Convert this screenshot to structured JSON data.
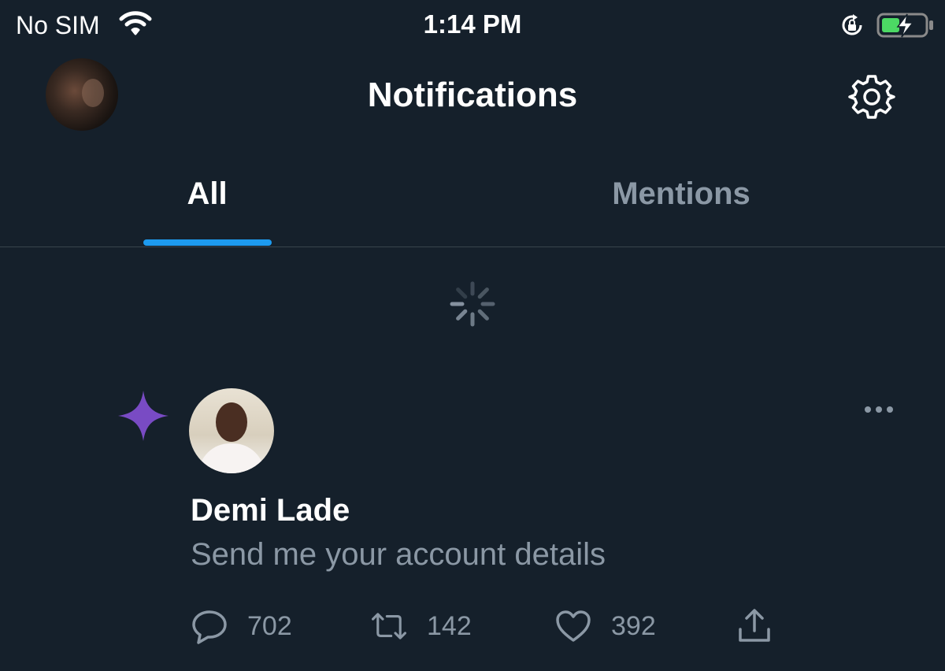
{
  "status_bar": {
    "carrier": "No SIM",
    "time": "1:14 PM",
    "battery_charging": true
  },
  "header": {
    "title": "Notifications",
    "settings_icon": "gear-icon",
    "avatar_icon": "profile-avatar"
  },
  "tabs": [
    {
      "label": "All",
      "active": true
    },
    {
      "label": "Mentions",
      "active": false
    }
  ],
  "colors": {
    "background": "#15202b",
    "accent": "#1d9bf0",
    "secondary_text": "#8b98a5",
    "sparkle": "#794bc4"
  },
  "notification": {
    "type_icon": "sparkle-icon",
    "user_name": "Demi Lade",
    "text": "Send me your account details",
    "actions": {
      "replies": "702",
      "retweets": "142",
      "likes": "392",
      "share_icon": "share-icon"
    }
  }
}
